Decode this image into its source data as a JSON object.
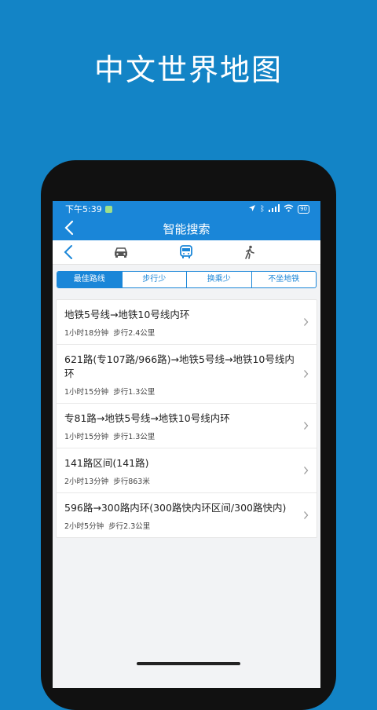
{
  "promo": {
    "title": "中文世界地图"
  },
  "status_bar": {
    "time": "下午5:39",
    "battery": "90"
  },
  "header": {
    "title": "智能搜索",
    "back_icon": "chevron-left-icon"
  },
  "modes": [
    {
      "name": "car-icon",
      "active": false
    },
    {
      "name": "bus-icon",
      "active": true
    },
    {
      "name": "walk-icon",
      "active": false
    }
  ],
  "tabs": [
    {
      "label": "最佳路线",
      "active": true
    },
    {
      "label": "步行少",
      "active": false
    },
    {
      "label": "换乘少",
      "active": false
    },
    {
      "label": "不坐地铁",
      "active": false
    }
  ],
  "routes": [
    {
      "title": "地铁5号线→地铁10号线内环",
      "duration": "1小时18分钟",
      "walk": "步行2.4公里"
    },
    {
      "title": "621路(专107路/966路)→地铁5号线→地铁10号线内环",
      "duration": "1小时15分钟",
      "walk": "步行1.3公里"
    },
    {
      "title": "专81路→地铁5号线→地铁10号线内环",
      "duration": "1小时15分钟",
      "walk": "步行1.3公里"
    },
    {
      "title": "141路区间(141路)",
      "duration": "2小时13分钟",
      "walk": "步行863米"
    },
    {
      "title": "596路→300路内环(300路快内环区间/300路快内)",
      "duration": "2小时5分钟",
      "walk": "步行2.3公里"
    }
  ],
  "colors": {
    "background": "#1384C6",
    "accent": "#1a86d8"
  }
}
